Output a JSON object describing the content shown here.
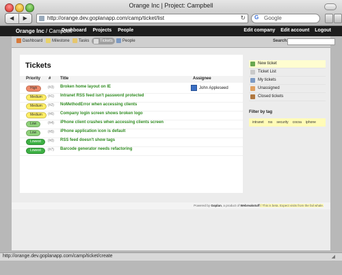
{
  "window": {
    "title": "Orange Inc | Project: Campbell"
  },
  "browser": {
    "url": "http://orange.dev.goplanapp.com/camp/ticket/list",
    "search_placeholder": "Google",
    "status_text": "http://orange.dev.goplanapp.com/camp/ticket/create"
  },
  "appbar": {
    "brand_company": "Orange Inc",
    "brand_sep": " / ",
    "brand_project": "Campbell",
    "nav": [
      "Dashboard",
      "Projects",
      "People"
    ],
    "right": [
      "Edit company",
      "Edit account",
      "Logout"
    ]
  },
  "subnav": {
    "items": [
      {
        "label": "Dashboard",
        "icon": "home-icon"
      },
      {
        "label": "Milestone",
        "icon": "milestone-icon"
      },
      {
        "label": "Tasks",
        "icon": "tasks-icon"
      },
      {
        "label": "Tickets",
        "icon": "tickets-icon",
        "active": true
      },
      {
        "label": "People",
        "icon": "people-icon"
      }
    ],
    "search_label": "Search:"
  },
  "tickets": {
    "heading": "Tickets",
    "columns": {
      "priority": "Priority",
      "num": "#",
      "title": "Title",
      "assignee": "Assignee"
    },
    "rows": [
      {
        "priority": "High",
        "color": "#f08a6a",
        "num": "(#3)",
        "title": "Broken home layout on IE",
        "assignee": "John Appleseed"
      },
      {
        "priority": "Medium",
        "color": "#ffee66",
        "num": "(#1)",
        "title": "Intranet RSS feed isn't password protected",
        "assignee": ""
      },
      {
        "priority": "Medium",
        "color": "#ffee66",
        "num": "(#2)",
        "title": "NoMethodError when accessing clients",
        "assignee": ""
      },
      {
        "priority": "Medium",
        "color": "#ffee66",
        "num": "(#6)",
        "title": "Company login screen shows broken logo",
        "assignee": ""
      },
      {
        "priority": "Low",
        "color": "#8fd17a",
        "num": "(#4)",
        "title": "iPhone client crashes when accessing clients screen",
        "assignee": ""
      },
      {
        "priority": "Low",
        "color": "#8fd17a",
        "num": "(#5)",
        "title": "iPhone application icon is default",
        "assignee": ""
      },
      {
        "priority": "Lowest",
        "color": "#3cb043",
        "num": "(#0)",
        "title": "RSS feed doesn't show tags",
        "assignee": ""
      },
      {
        "priority": "Lowest",
        "color": "#3cb043",
        "num": "(#7)",
        "title": "Barcode generator needs refactoring",
        "assignee": ""
      }
    ]
  },
  "sidebar": {
    "items": [
      {
        "label": "New ticket",
        "icon": "new-ticket-icon",
        "highlight": true
      },
      {
        "label": "Ticket List",
        "icon": "ticket-list-icon"
      },
      {
        "label": "My tickets",
        "icon": "my-tickets-icon"
      },
      {
        "label": "Unassigned",
        "icon": "unassigned-icon"
      },
      {
        "label": "Closed tickets",
        "icon": "closed-tickets-icon"
      }
    ],
    "filter_title": "Filter by tag",
    "tags": [
      "intranet",
      "rss",
      "security",
      "cocoa",
      "iphone"
    ]
  },
  "footer": {
    "prefix": "Powered by ",
    "product": "Goplan",
    "middle": ", a product of ",
    "company": "Webreakstuff",
    "note": " / This is beta. Expect visits from the fail whale."
  }
}
